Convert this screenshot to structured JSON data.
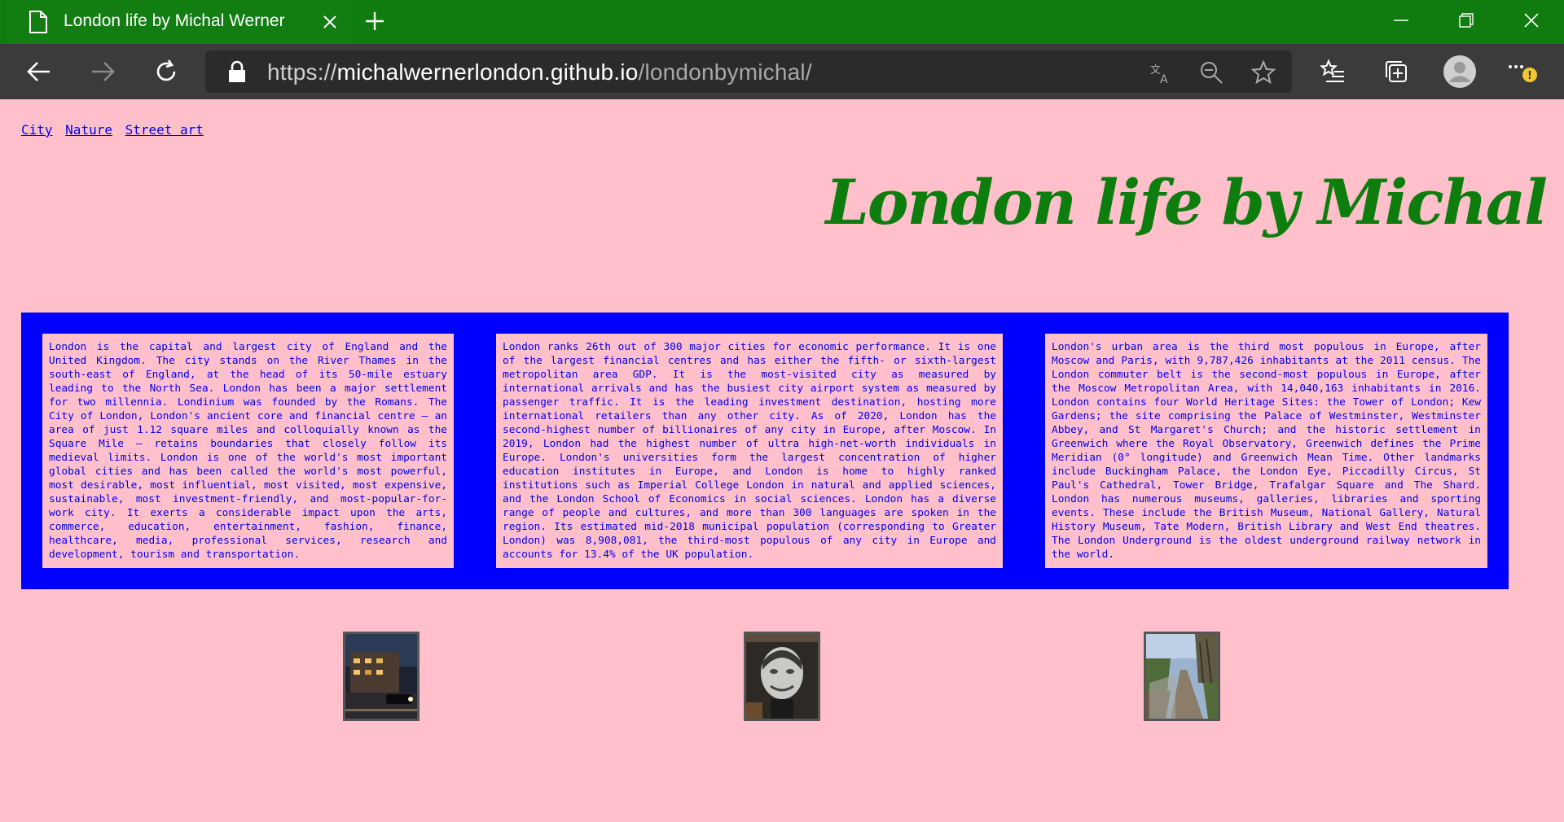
{
  "browser": {
    "tab_title": "London life by Michal Werner",
    "url_scheme": "https://",
    "url_host": "michalwernerlondon.github.io",
    "url_path": "/londonbymichal/",
    "accent_color": "#107c10",
    "icons": [
      "document-icon",
      "close-icon",
      "new-tab-icon",
      "minimize-icon",
      "restore-icon",
      "window-close-icon",
      "back-icon",
      "forward-icon",
      "refresh-icon",
      "lock-icon",
      "translate-icon",
      "zoom-out-icon",
      "favorite-star-icon",
      "favorites-list-icon",
      "collections-icon",
      "profile-avatar-icon",
      "more-menu-icon"
    ]
  },
  "page": {
    "nav": [
      "City",
      "Nature",
      "Street art"
    ],
    "title": "London life by Michal",
    "background_color": "#ffc0cb",
    "band_color": "#0000ff",
    "title_color": "#0d7d0d",
    "paragraphs": [
      "London is the capital and largest city of England and the United Kingdom. The city stands on the River Thames in the south-east of England, at the head of its 50-mile estuary leading to the North Sea. London has been a major settlement for two millennia. Londinium was founded by the Romans. The City of London, London's ancient core and financial centre – an area of just 1.12 square miles and colloquially known as the Square Mile – retains boundaries that closely follow its medieval limits. London is one of the world's most important global cities and has been called the world's most powerful, most desirable, most influential, most visited, most expensive, sustainable, most investment-friendly, and most-popular-for-work city. It exerts a considerable impact upon the arts, commerce, education, entertainment, fashion, finance, healthcare, media, professional services, research and development, tourism and transportation.",
      "London ranks 26th out of 300 major cities for economic performance. It is one of the largest financial centres and has either the fifth- or sixth-largest metropolitan area GDP. It is the most-visited city as measured by international arrivals and has the busiest city airport system as measured by passenger traffic. It is the leading investment destination, hosting more international retailers than any other city. As of 2020, London has the second-highest number of billionaires of any city in Europe, after Moscow. In 2019, London had the highest number of ultra high-net-worth individuals in Europe. London's universities form the largest concentration of higher education institutes in Europe, and London is home to highly ranked institutions such as Imperial College London in natural and applied sciences, and the London School of Economics in social sciences. London has a diverse range of people and cultures, and more than 300 languages are spoken in the region. Its estimated mid-2018 municipal population (corresponding to Greater London) was 8,908,081, the third-most populous of any city in Europe and accounts for 13.4% of the UK population.",
      "London's urban area is the third most populous in Europe, after Moscow and Paris, with 9,787,426 inhabitants at the 2011 census. The London commuter belt is the second-most populous in Europe, after the Moscow Metropolitan Area, with 14,040,163 inhabitants in 2016. London contains four World Heritage Sites: the Tower of London; Kew Gardens; the site comprising the Palace of Westminster, Westminster Abbey, and St Margaret's Church; and the historic settlement in Greenwich where the Royal Observatory, Greenwich defines the Prime Meridian (0° longitude) and Greenwich Mean Time. Other landmarks include Buckingham Palace, the London Eye, Piccadilly Circus, St Paul's Cathedral, Tower Bridge, Trafalgar Square and The Shard. London has numerous museums, galleries, libraries and sporting events. These include the British Museum, National Gallery, Natural History Museum, Tate Modern, British Library and West End theatres. The London Underground is the oldest underground railway network in the world."
    ],
    "thumbnails": [
      "city-night-street-photo",
      "street-art-portrait-photo",
      "nature-path-photo"
    ]
  }
}
